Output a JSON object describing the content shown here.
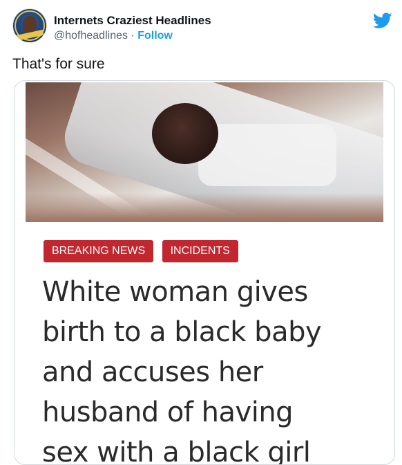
{
  "account": {
    "display_name": "Internets Craziest Headlines",
    "handle": "@hofheadlines",
    "separator": "·",
    "follow_label": "Follow"
  },
  "icons": {
    "platform": "twitter-bird-icon",
    "brand_color": "#1d9bf0"
  },
  "tweet": {
    "text": "That's for sure"
  },
  "media": {
    "tags": [
      "BREAKING NEWS",
      "INCIDENTS"
    ],
    "tag_color": "#c2262e",
    "headline_lines": [
      "White woman gives",
      "birth to a black baby",
      "and accuses her",
      "husband of having",
      "sex with a black girl"
    ]
  }
}
